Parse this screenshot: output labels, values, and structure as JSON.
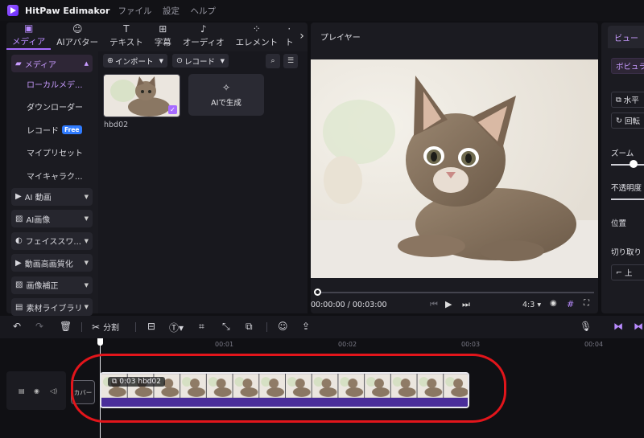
{
  "app": {
    "name": "HitPaw Edimakor",
    "menu": [
      "ファイル",
      "設定",
      "ヘルプ"
    ]
  },
  "tabs": [
    {
      "label": "メディア",
      "icon": "media-icon",
      "active": true
    },
    {
      "label": "AIアバター",
      "icon": "avatar-icon"
    },
    {
      "label": "テキスト",
      "icon": "text-icon"
    },
    {
      "label": "字幕",
      "icon": "subtitle-icon"
    },
    {
      "label": "オーディオ",
      "icon": "audio-icon"
    },
    {
      "label": "エレメント",
      "icon": "element-icon"
    },
    {
      "label": "ト",
      "icon": "more-icon"
    }
  ],
  "sidebar": {
    "media": "メディア",
    "sub": [
      "ローカルメデ...",
      "ダウンローダー",
      "レコード",
      "マイプリセット",
      "マイキャラク..."
    ],
    "record_badge": "Free",
    "groups": [
      "AI 動画",
      "AI画像",
      "フェイススワ...",
      "動画高画質化",
      "画像補正",
      "素材ライブラリ"
    ]
  },
  "media": {
    "import": "インポート",
    "record": "レコード",
    "clip_name": "hbd02",
    "ai_generate": "AIで生成"
  },
  "player": {
    "title": "プレイヤー",
    "time": "00:00:00 / 00:03:00",
    "ratio": "4:3"
  },
  "right_panel": {
    "tab": "ビュー",
    "tag": "ボビュラ",
    "flip": "水平",
    "rotate": "回転",
    "zoom": "ズーム",
    "opacity": "不透明度",
    "position": "位置",
    "crop": "切り取り",
    "top": "上"
  },
  "toolbar": {
    "split": "分割"
  },
  "timeline": {
    "ticks": [
      "00:01",
      "00:02",
      "00:03",
      "00:04"
    ],
    "cover": "カバー",
    "clip_label": "0:03 hbd02"
  },
  "colors": {
    "accent": "#a66bff",
    "annotation": "#e2151b"
  }
}
